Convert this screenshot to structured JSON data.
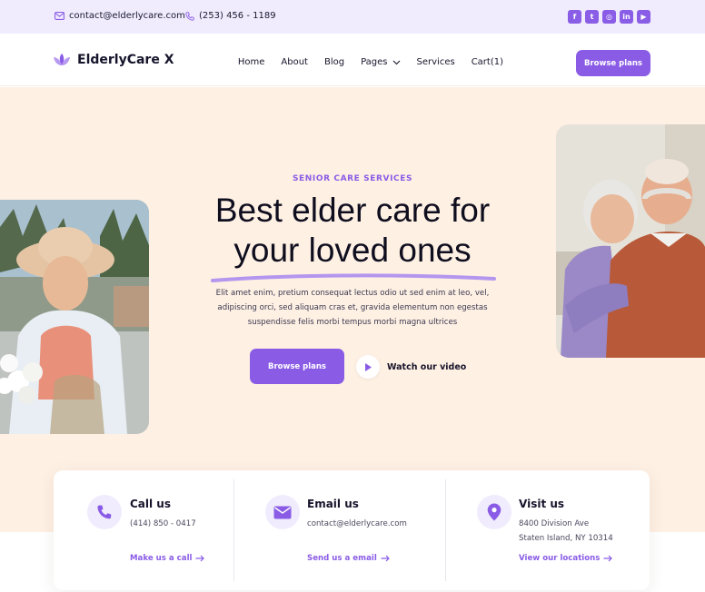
{
  "topbar": {
    "email": "contact@elderlycare.com",
    "phone": "(253) 456 - 1189",
    "socials": [
      {
        "icon": "facebook-icon",
        "glyph": "f"
      },
      {
        "icon": "twitter-icon",
        "glyph": "t"
      },
      {
        "icon": "instagram-icon",
        "glyph": "◎"
      },
      {
        "icon": "linkedin-icon",
        "glyph": "in"
      },
      {
        "icon": "youtube-icon",
        "glyph": "▶"
      }
    ]
  },
  "header": {
    "brand": "ElderlyCare X",
    "nav": [
      "Home",
      "About",
      "Blog",
      "Pages",
      "Services",
      "Cart(1)"
    ],
    "cta": "Browse plans"
  },
  "hero": {
    "eyebrow": "SENIOR CARE SERVICES",
    "title_line1": "Best elder care for",
    "title_line2": "your loved ones",
    "description": "Elit amet enim, pretium consequat lectus odio ut sed enim at leo, vel, adipiscing orci, sed aliquam cras et, gravida elementum non egestas suspendisse felis morbi tempus morbi magna ultrices",
    "primary_button": "Browse plans",
    "video_link": "Watch our video"
  },
  "contact_cards": [
    {
      "icon": "phone-icon",
      "title": "Call us",
      "lines": [
        "(414) 850 - 0417"
      ],
      "link": "Make us a call"
    },
    {
      "icon": "envelope-icon",
      "title": "Email us",
      "lines": [
        "contact@elderlycare.com"
      ],
      "link": "Send us a email"
    },
    {
      "icon": "location-pin-icon",
      "title": "Visit us",
      "lines": [
        "8400 Division Ave",
        "Staten Island, NY 10314"
      ],
      "link": "View our locations"
    }
  ],
  "colors": {
    "accent": "#8a5ce6",
    "topbar_bg": "#f0ecfd",
    "hero_bg": "#fef0e3",
    "text_dark": "#0f0e1f"
  }
}
